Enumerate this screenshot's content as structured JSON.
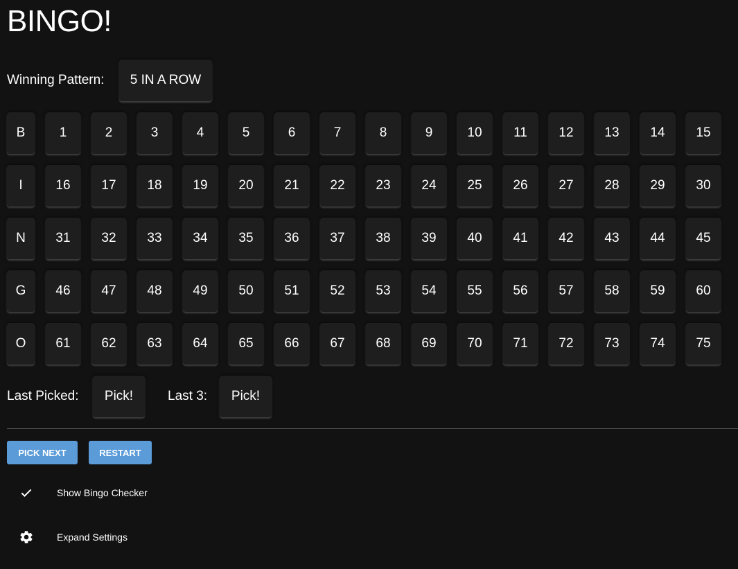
{
  "title": "BINGO!",
  "winning_pattern": {
    "label": "Winning Pattern:",
    "value": "5 IN A ROW"
  },
  "board": [
    {
      "letter": "B",
      "numbers": [
        "1",
        "2",
        "3",
        "4",
        "5",
        "6",
        "7",
        "8",
        "9",
        "10",
        "11",
        "12",
        "13",
        "14",
        "15"
      ]
    },
    {
      "letter": "I",
      "numbers": [
        "16",
        "17",
        "18",
        "19",
        "20",
        "21",
        "22",
        "23",
        "24",
        "25",
        "26",
        "27",
        "28",
        "29",
        "30"
      ]
    },
    {
      "letter": "N",
      "numbers": [
        "31",
        "32",
        "33",
        "34",
        "35",
        "36",
        "37",
        "38",
        "39",
        "40",
        "41",
        "42",
        "43",
        "44",
        "45"
      ]
    },
    {
      "letter": "G",
      "numbers": [
        "46",
        "47",
        "48",
        "49",
        "50",
        "51",
        "52",
        "53",
        "54",
        "55",
        "56",
        "57",
        "58",
        "59",
        "60"
      ]
    },
    {
      "letter": "O",
      "numbers": [
        "61",
        "62",
        "63",
        "64",
        "65",
        "66",
        "67",
        "68",
        "69",
        "70",
        "71",
        "72",
        "73",
        "74",
        "75"
      ]
    }
  ],
  "last_picked": {
    "label": "Last Picked:",
    "value": "Pick!"
  },
  "last_3": {
    "label": "Last 3:",
    "value": "Pick!"
  },
  "buttons": {
    "pick_next": "PICK NEXT",
    "restart": "RESTART"
  },
  "options": {
    "show_checker": "Show Bingo Checker",
    "expand_settings": "Expand Settings"
  },
  "colors": {
    "background": "#121212",
    "tile": "#1e1e1e",
    "accent": "#5a9bd8"
  }
}
